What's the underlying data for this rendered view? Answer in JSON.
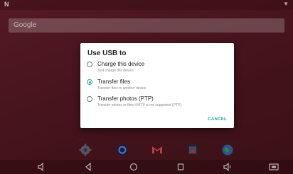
{
  "status_bar": {
    "notification_glyph": "N",
    "battery_glyph": "▼"
  },
  "search": {
    "logo_text": "Google"
  },
  "dialog": {
    "title": "Use USB to",
    "options": [
      {
        "label": "Charge this device",
        "description": "Just charge this device",
        "selected": false
      },
      {
        "label": "Transfer files",
        "description": "Transfer files to another device",
        "selected": true
      },
      {
        "label": "Transfer photos (PTP)",
        "description": "Transfer photos or files if MTP is not supported (PTP)",
        "selected": false
      }
    ],
    "cancel_label": "CANCEL"
  },
  "dock": {
    "apps": [
      "settings-icon",
      "browser-icon",
      "gmail-icon",
      "gallery-icon",
      "globe-icon"
    ]
  },
  "navigation": {
    "items": [
      "volume-down-icon",
      "back-icon",
      "home-icon",
      "recents-icon",
      "volume-up-icon",
      "screenshot-icon"
    ]
  },
  "colors": {
    "accent": "#26a69a",
    "wallpaper": "#4a1720",
    "dialog_bg": "#ffffff"
  }
}
